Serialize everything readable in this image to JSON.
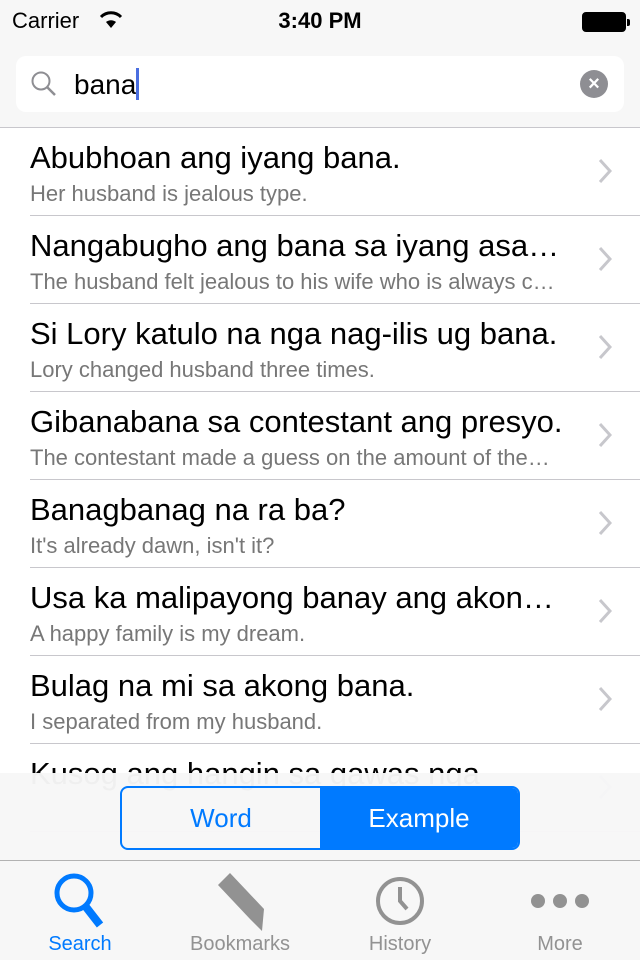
{
  "status": {
    "carrier": "Carrier",
    "time": "3:40 PM"
  },
  "search": {
    "value": "bana"
  },
  "results": [
    {
      "title": "Abubhoan ang iyang bana.",
      "subtitle": "Her husband is jealous type."
    },
    {
      "title": "Nangabugho ang bana sa iyang asawa nga alegre kaayo.",
      "subtitle": "The husband felt jealous to his wife who is always cheerful."
    },
    {
      "title": "Si Lory katulo na nga nag-ilis ug bana.",
      "subtitle": "Lory changed husband three times."
    },
    {
      "title": "Gibanabana sa contestant ang presyo.",
      "subtitle": "The contestant made a guess on the amount of the price."
    },
    {
      "title": "Banagbanag na ra ba?",
      "subtitle": "It's already dawn, isn't it?"
    },
    {
      "title": "Usa ka malipayong banay ang akong damgo.",
      "subtitle": "A happy family is my dream."
    },
    {
      "title": "Bulag na mi sa akong bana.",
      "subtitle": "I separated from my husband."
    },
    {
      "title": "Kusog ang hangin sa gawas nga",
      "subtitle": ""
    }
  ],
  "segment": {
    "options": [
      "Word",
      "Example"
    ],
    "selected": "Example"
  },
  "tabs": [
    {
      "label": "Search",
      "icon": "search-icon",
      "active": true
    },
    {
      "label": "Bookmarks",
      "icon": "bookmark-icon"
    },
    {
      "label": "History",
      "icon": "clock-icon"
    },
    {
      "label": "More",
      "icon": "more-icon"
    }
  ],
  "colors": {
    "accent": "#007aff",
    "inactive": "#929292"
  }
}
